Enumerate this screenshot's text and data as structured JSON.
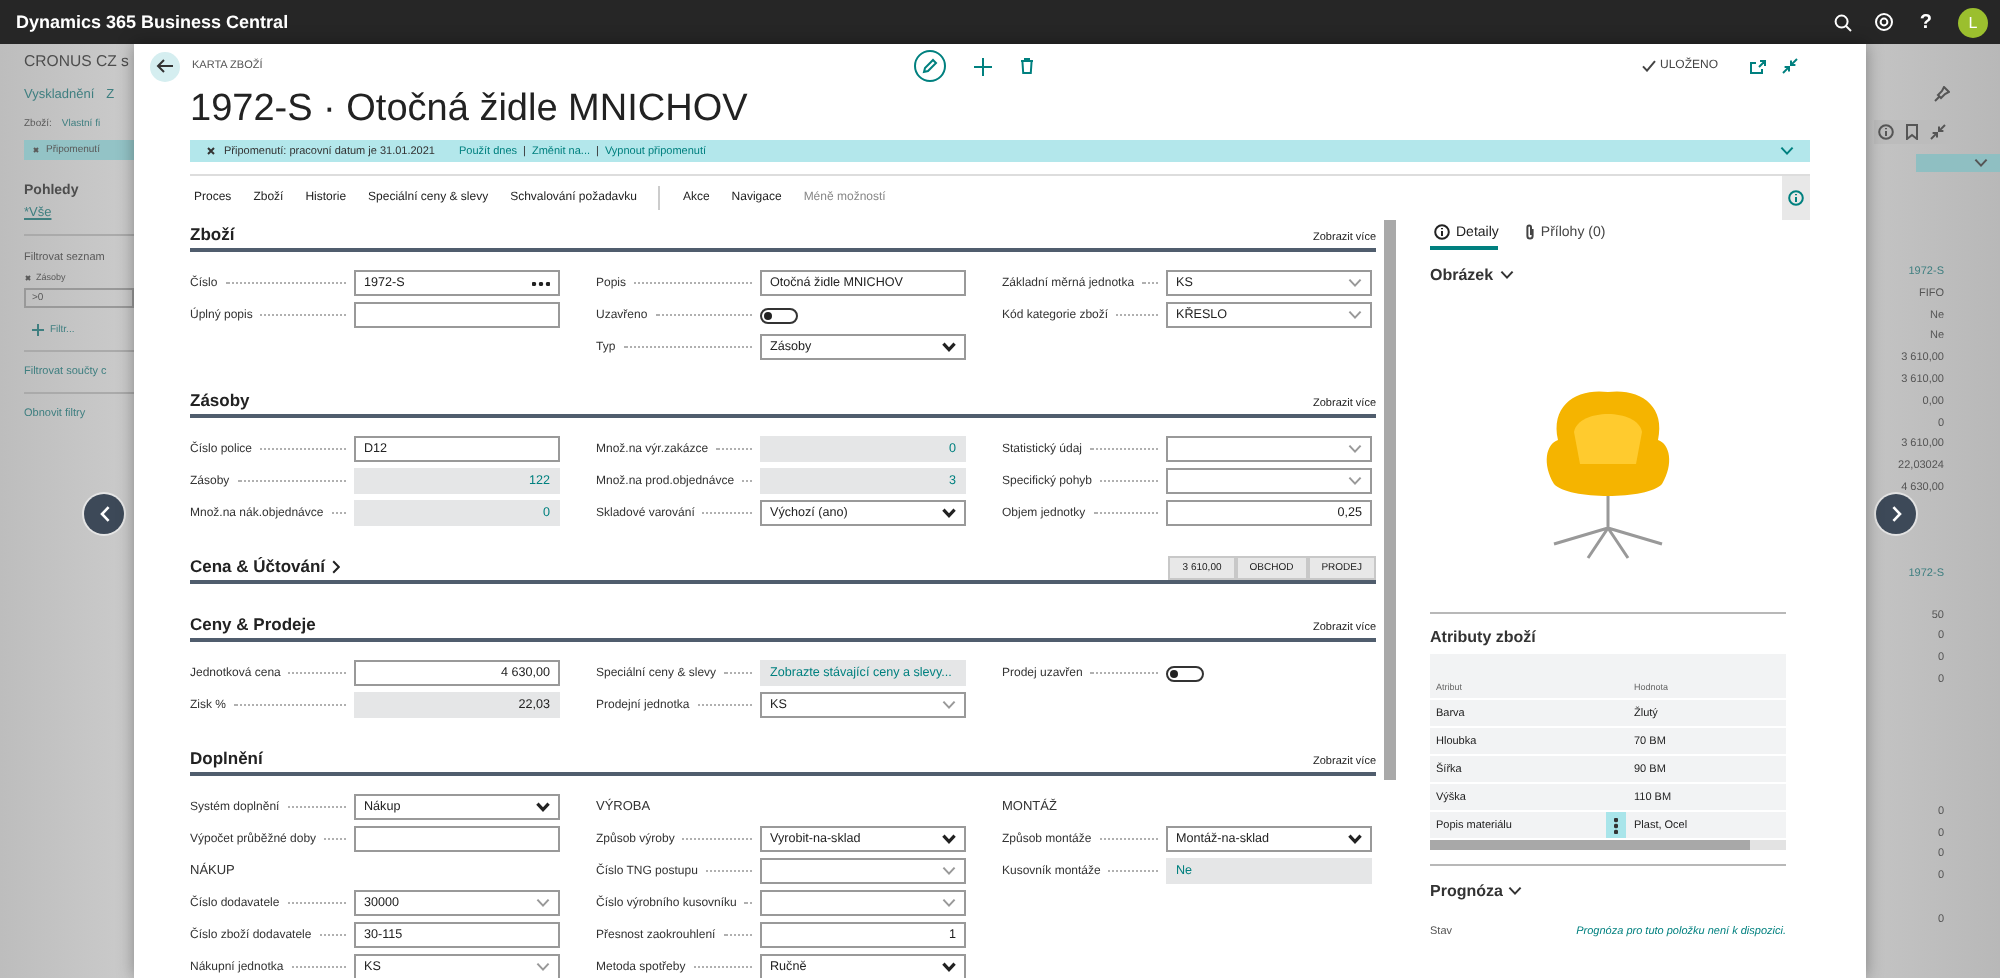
{
  "top_bar": {
    "app_title": "Dynamics 365 Business Central",
    "help": "?",
    "avatar_initial": "L"
  },
  "background_left": {
    "company": "CRONUS CZ s",
    "actions": [
      "Vyskladnění",
      "Z"
    ],
    "filter_label": "Zboží:",
    "filter_value": "Vlastní fi",
    "filter_chip": "Připomenutí",
    "views_title": "Pohledy",
    "view": "*Vše",
    "filter_list_title": "Filtrovat seznam",
    "filter_field": "Zásoby",
    "filter_input": ">0",
    "add_filter": "Filtr...",
    "filter_totals": "Filtrovat součty c",
    "reset_filters": "Obnovit filtry"
  },
  "background_right": {
    "blocks": [
      {
        "link": "1972-S",
        "values": [
          "FIFO",
          "Ne",
          "Ne",
          "3 610,00",
          "3 610,00",
          "0,00",
          "0",
          "3 610,00",
          "22,03024",
          "4 630,00"
        ]
      },
      {
        "link": "1972-S",
        "values": [
          "50",
          "0",
          "0",
          "0"
        ]
      },
      {
        "values": [
          "0",
          "0",
          "0",
          "0"
        ]
      },
      {
        "values": [
          "0"
        ]
      }
    ]
  },
  "card": {
    "caption": "KARTA ZBOŽÍ",
    "title": "1972-S · Otočná židle MNICHOV",
    "save_status": "ULOŽENO"
  },
  "notification": {
    "message": "Připomenutí: pracovní datum je 31.01.2021",
    "links": [
      "Použít dnes",
      "Změnit na...",
      "Vypnout připomenutí"
    ],
    "separator": "|"
  },
  "action_bar": {
    "primary": [
      "Proces",
      "Zboží",
      "Historie",
      "Speciální ceny & slevy",
      "Schvalování požadavku"
    ],
    "secondary": [
      "Akce",
      "Navigace"
    ],
    "more": "Méně možností"
  },
  "form_sections": [
    {
      "title": "Zboží",
      "expanded": true,
      "show_more": "Zobrazit více",
      "columns": [
        {
          "fields": [
            {
              "label": "Číslo",
              "kind": "assist",
              "value": "1972-S"
            },
            {
              "label": "Úplný popis",
              "kind": "text"
            }
          ]
        },
        {
          "fields": [
            {
              "label": "Popis",
              "kind": "text",
              "value": "Otočná židle MNICHOV"
            },
            {
              "label": "Uzavřeno",
              "kind": "toggle",
              "on": false
            },
            {
              "label": "Typ",
              "kind": "select",
              "value": "Zásoby"
            }
          ]
        },
        {
          "fields": [
            {
              "label": "Základní měrná jednotka",
              "kind": "combo",
              "value": "KS"
            },
            {
              "label": "Kód kategorie zboží",
              "kind": "combo",
              "value": "KŘESLO"
            }
          ]
        }
      ]
    },
    {
      "title": "Zásoby",
      "expanded": true,
      "show_more": "Zobrazit více",
      "columns": [
        {
          "fields": [
            {
              "label": "Číslo police",
              "kind": "text",
              "value": "D12"
            },
            {
              "label": "Zásoby",
              "kind": "readonly",
              "value": "122"
            },
            {
              "label": "Množ.na nák.objednávce",
              "kind": "readonly",
              "value": "0"
            }
          ]
        },
        {
          "fields": [
            {
              "label": "Množ.na výr.zakázce",
              "kind": "readonly",
              "value": "0"
            },
            {
              "label": "Množ.na prod.objednávce",
              "kind": "readonly",
              "value": "3"
            },
            {
              "label": "Skladové varování",
              "kind": "select",
              "value": "Výchozí (ano)"
            }
          ]
        },
        {
          "fields": [
            {
              "label": "Statistický údaj",
              "kind": "combo"
            },
            {
              "label": "Specifický pohyb",
              "kind": "combo"
            },
            {
              "label": "Objem jednotky",
              "kind": "number",
              "value": "0,25"
            }
          ]
        }
      ]
    },
    {
      "title": "Cena & Účtování",
      "expanded": false,
      "cues": [
        "3 610,00",
        "OBCHOD",
        "PRODEJ"
      ]
    },
    {
      "title": "Ceny & Prodeje",
      "expanded": true,
      "show_more": "Zobrazit více",
      "columns": [
        {
          "fields": [
            {
              "label": "Jednotková cena",
              "kind": "number",
              "value": "4 630,00"
            },
            {
              "label": "Zisk %",
              "kind": "readonly-plain",
              "value": "22,03"
            }
          ]
        },
        {
          "fields": [
            {
              "label": "Speciální ceny & slevy",
              "kind": "readonly-link",
              "value": "Zobrazte stávající ceny a slevy..."
            },
            {
              "label": "Prodejní jednotka",
              "kind": "combo",
              "value": "KS"
            }
          ]
        },
        {
          "fields": [
            {
              "label": "Prodej uzavřen",
              "kind": "toggle",
              "on": false
            }
          ]
        }
      ]
    },
    {
      "title": "Doplnění",
      "expanded": true,
      "show_more": "Zobrazit více",
      "columns": [
        {
          "fields": [
            {
              "label": "Systém doplnění",
              "kind": "select",
              "value": "Nákup"
            },
            {
              "label": "Výpočet průběžné doby",
              "kind": "text"
            },
            {
              "label": "NÁKUP",
              "kind": "heading"
            },
            {
              "label": "Číslo dodavatele",
              "kind": "combo",
              "value": "30000"
            },
            {
              "label": "Číslo zboží dodavatele",
              "kind": "text",
              "value": "30-115"
            },
            {
              "label": "Nákupní jednotka",
              "kind": "combo",
              "value": "KS"
            }
          ]
        },
        {
          "fields": [
            {
              "label": "VÝROBA",
              "kind": "heading"
            },
            {
              "label": "Způsob výroby",
              "kind": "select",
              "value": "Vyrobit-na-sklad"
            },
            {
              "label": "Číslo TNG postupu",
              "kind": "combo"
            },
            {
              "label": "Číslo výrobního kusovníku",
              "kind": "combo"
            },
            {
              "label": "Přesnost zaokrouhlení",
              "kind": "number",
              "value": "1"
            },
            {
              "label": "Metoda spotřeby",
              "kind": "select",
              "value": "Ručně"
            }
          ]
        },
        {
          "fields": [
            {
              "label": "MONTÁŽ",
              "kind": "heading"
            },
            {
              "label": "Způsob montáže",
              "kind": "select",
              "value": "Montáž-na-sklad"
            },
            {
              "label": "Kusovník montáže",
              "kind": "readonly-link",
              "value": "Ne"
            }
          ]
        }
      ]
    }
  ],
  "factbox": {
    "tabs": [
      {
        "label": "Detaily",
        "selected": true,
        "kind": "info"
      },
      {
        "label": "Přílohy (0)",
        "selected": false,
        "kind": "attachment"
      }
    ],
    "picture_title": "Obrázek",
    "attributes_title": "Atributy zboží",
    "attribute_columns": [
      "Atribut",
      "Hodnota"
    ],
    "attributes": [
      {
        "attribute": "Barva",
        "value": "Žlutý",
        "selected": false
      },
      {
        "attribute": "Hloubka",
        "value": "70 BM",
        "selected": false
      },
      {
        "attribute": "Šířka",
        "value": "90 BM",
        "selected": false
      },
      {
        "attribute": "Výška",
        "value": "110 BM",
        "selected": false
      },
      {
        "attribute": "Popis materiálu",
        "value": "Plast, Ocel",
        "selected": true
      }
    ],
    "forecast_title": "Prognóza",
    "forecast_label": "Stav",
    "forecast_value": "Prognóza pro tuto položku není k dispozici."
  }
}
